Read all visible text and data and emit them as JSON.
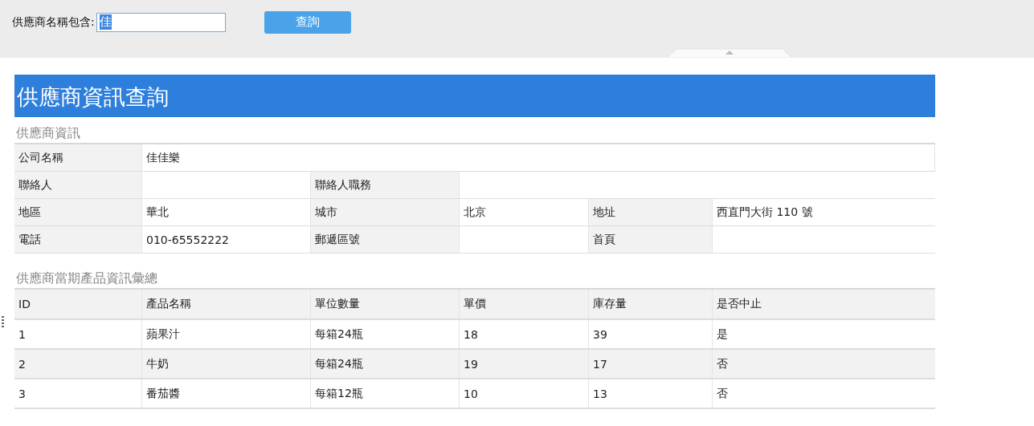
{
  "query": {
    "label": "供應商名稱包含:",
    "value": "佳",
    "value_selected": true,
    "button": "查詢"
  },
  "report": {
    "title": "供應商資訊查詢",
    "info_section": {
      "heading": "供應商資訊",
      "rows": [
        [
          {
            "kind": "label",
            "text": "公司名稱"
          },
          {
            "kind": "value",
            "text": "佳佳樂"
          }
        ],
        [
          {
            "kind": "label",
            "text": "聯絡人"
          },
          {
            "kind": "value"
          },
          {
            "kind": "label",
            "text": "聯絡人職務"
          },
          {
            "kind": "value"
          }
        ],
        [
          {
            "kind": "label",
            "text": "地區"
          },
          {
            "kind": "value",
            "text": "華北"
          },
          {
            "kind": "label",
            "text": "城市"
          },
          {
            "kind": "value",
            "text": "北京"
          },
          {
            "kind": "label",
            "text": "地址"
          },
          {
            "kind": "value",
            "text": "西直門大街 110 號"
          }
        ],
        [
          {
            "kind": "label",
            "text": "電話"
          },
          {
            "kind": "value",
            "text": "010-65552222"
          },
          {
            "kind": "label",
            "text": "郵遞區號"
          },
          {
            "kind": "value"
          },
          {
            "kind": "label",
            "text": "首頁"
          },
          {
            "kind": "value"
          }
        ]
      ]
    },
    "products_section": {
      "heading": "供應商當期產品資訊彙總",
      "columns": [
        "ID",
        "產品名稱",
        "單位數量",
        "單價",
        "庫存量",
        "是否中止"
      ],
      "rows": [
        [
          "1",
          "蘋果汁",
          "每箱24瓶",
          "18",
          "39",
          "是"
        ],
        [
          "2",
          "牛奶",
          "每箱24瓶",
          "19",
          "17",
          "否"
        ],
        [
          "3",
          "番茄醬",
          "每箱12瓶",
          "10",
          "13",
          "否"
        ]
      ]
    }
  }
}
